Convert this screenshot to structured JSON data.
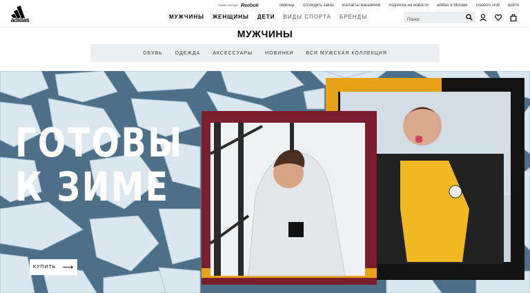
{
  "header": {
    "logo_text": "adidas",
    "also_label": "Также смотри",
    "partner": "Reebok",
    "util_links": [
      "помощь",
      "отследить заказ",
      "контакты магазинов",
      "подписка на новости",
      "adidas в Москве",
      "creators club",
      "войти"
    ],
    "nav": [
      {
        "label": "МУЖЧИНЫ"
      },
      {
        "label": "ЖЕНЩИНЫ"
      },
      {
        "label": "ДЕТИ"
      },
      {
        "label": "ВИДЫ СПОРТА"
      },
      {
        "label": "БРЕНДЫ"
      }
    ],
    "search_placeholder": "Поиск",
    "icons": [
      "search-icon",
      "account-icon",
      "wishlist-heart-icon",
      "cart-bag-icon"
    ]
  },
  "category": {
    "title": "МУЖЧИНЫ",
    "subnav": [
      "ОБУВЬ",
      "ОДЕЖДА",
      "АКСЕССУАРЫ",
      "НОВИНКИ",
      "ВСЯ МУЖСКАЯ КОЛЛЕКЦИЯ"
    ]
  },
  "hero": {
    "headline_line1": "ГОТОВЫ",
    "headline_line2": "К ЗИМЕ",
    "cta_label": "КУПИТЬ",
    "cta_arrow": "⟶"
  },
  "colors": {
    "ice_water": "#4d6f88",
    "ice": "#dde9f1",
    "maroon": "#7a1e2e",
    "gold": "#e8a21a",
    "black": "#141414",
    "jacket_yellow": "#f2b824"
  }
}
